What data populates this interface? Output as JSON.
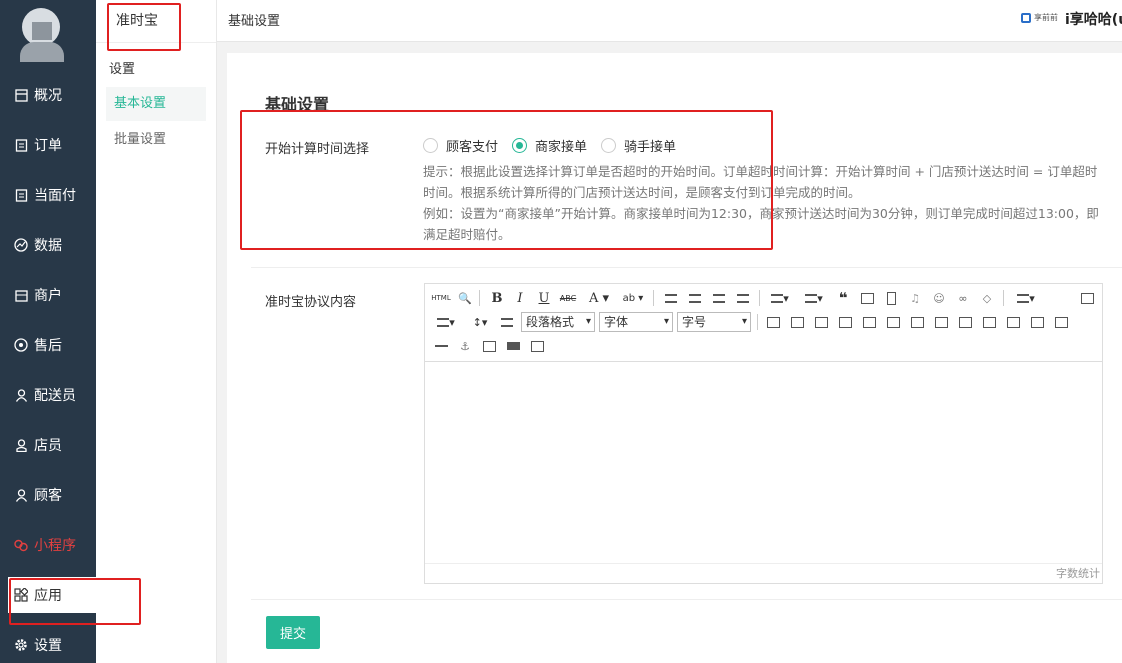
{
  "nav": {
    "items": [
      {
        "label": "概况",
        "icon": "dashboard-icon"
      },
      {
        "label": "订单",
        "icon": "order-icon"
      },
      {
        "label": "当面付",
        "icon": "pay-icon"
      },
      {
        "label": "数据",
        "icon": "chart-icon"
      },
      {
        "label": "商户",
        "icon": "store-icon"
      },
      {
        "label": "售后",
        "icon": "aftersale-icon"
      },
      {
        "label": "配送员",
        "icon": "courier-icon"
      },
      {
        "label": "店员",
        "icon": "clerk-icon"
      },
      {
        "label": "顾客",
        "icon": "customer-icon"
      },
      {
        "label": "小程序",
        "icon": "miniprogram-icon"
      },
      {
        "label": "应用",
        "icon": "apps-icon"
      },
      {
        "label": "设置",
        "icon": "gear-icon"
      }
    ],
    "red_color": "#e04040"
  },
  "sub": {
    "title": "准时宝",
    "group": "设置",
    "items": [
      "基本设置",
      "批量设置"
    ]
  },
  "topbar": {
    "page_title": "基础设置",
    "logo_text": "享前前",
    "user": "i享哈哈(u"
  },
  "form": {
    "heading": "基础设置",
    "time_label": "开始计算时间选择",
    "options": [
      "顾客支付",
      "商家接单",
      "骑手接单"
    ],
    "selected": "商家接单",
    "hint1": "提示：根据此设置选择计算订单是否超时的开始时间。订单超时时间计算：开始计算时间 + 门店预计送达时间 = 订单超时时间。根据系统计算所得的门店预计送达时间，是顾客支付到订单完成的时间。",
    "hint2": "例如：设置为“商家接单”开始计算。商家接单时间为12:30，商家预计送达时间为30分钟，则订单完成时间超过13:00，即满足超时赔付。",
    "agreement_label": "准时宝协议内容",
    "toolbar": {
      "html": "HTML",
      "paragraph": "段落格式",
      "font": "字体",
      "size": "字号"
    },
    "word_count": "字数统计",
    "submit": "提交"
  },
  "accent": "#26b796"
}
